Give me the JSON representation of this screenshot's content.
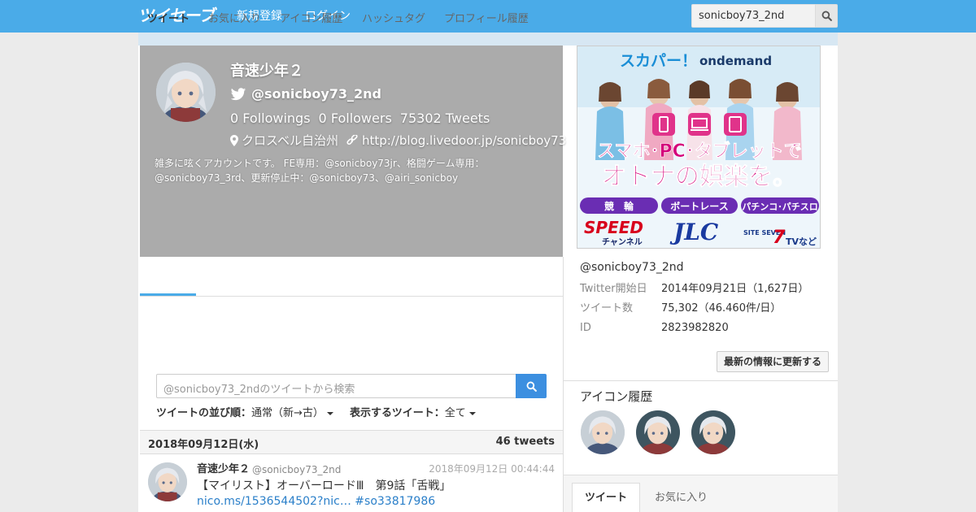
{
  "navbar": {
    "brand": "ツイセーブ",
    "signup": "新規登録",
    "login": "ログイン",
    "search_value": "sonicboy73_2nd"
  },
  "profile": {
    "name": "音速少年２",
    "handle": "@sonicboy73_2nd",
    "followings_count": "0",
    "followings_label": "Followings",
    "followers_count": "0",
    "followers_label": "Followers",
    "tweets_count": "75302",
    "tweets_label": "Tweets",
    "location": "クロスベル自治州",
    "url": "http://blog.livedoor.jp/sonicboy73",
    "bio": "雑多に呟くアカウントです。 FE専用：@sonicboy73jr、格闘ゲーム専用：@sonicboy73_3rd、更新停止中：@sonicboy73、@airi_sonicboy"
  },
  "tabs": [
    "ツイート",
    "お気に入り",
    "アイコン履歴",
    "ハッシュタグ",
    "プロフィール履歴"
  ],
  "tweet_search": {
    "placeholder": "@sonicboy73_2ndのツイートから検索"
  },
  "sort": {
    "order_label": "ツイートの並び順：",
    "order_value": "通常（新→古）",
    "display_label": "表示するツイート：",
    "display_value": "全て"
  },
  "date_bar": {
    "date": "2018年09月12日(水)",
    "count": "46 tweets"
  },
  "tweet": {
    "name": "音速少年２",
    "handle": "@sonicboy73_2nd",
    "time": "2018年09月12日 00:44:44",
    "text": "【マイリスト】オーバーロードⅢ　第9話「舌戦」",
    "link": "nico.ms/1536544502?nic…",
    "hashtag": "#so33817986"
  },
  "ad": {
    "logo": "スカパー！",
    "logo_sub": "ondemand",
    "headline1": "スマホ･PC･タブレットで",
    "headline2": "オトナの娯楽を。",
    "cat1": "競　輪",
    "cat2": "ボートレース",
    "cat3": "パチンコ･パチスロ",
    "brand1": "SPEED",
    "brand1_sub": "チャンネル",
    "brand2": "JLC",
    "brand3": "SITE SEVEN",
    "brand3_tv": "TV",
    "brand3_suffix": "など"
  },
  "right": {
    "handle": "@sonicboy73_2nd",
    "rows": [
      {
        "k": "Twitter開始日",
        "v": "2014年09月21日（1,627日）"
      },
      {
        "k": "ツイート数",
        "v": "75,302（46.460件/日）"
      },
      {
        "k": "ID",
        "v": "2823982820"
      }
    ],
    "update_button": "最新の情報に更新する",
    "icon_history_title": "アイコン履歴",
    "tab_active": "ツイート",
    "tab_other": "お気に入り"
  }
}
